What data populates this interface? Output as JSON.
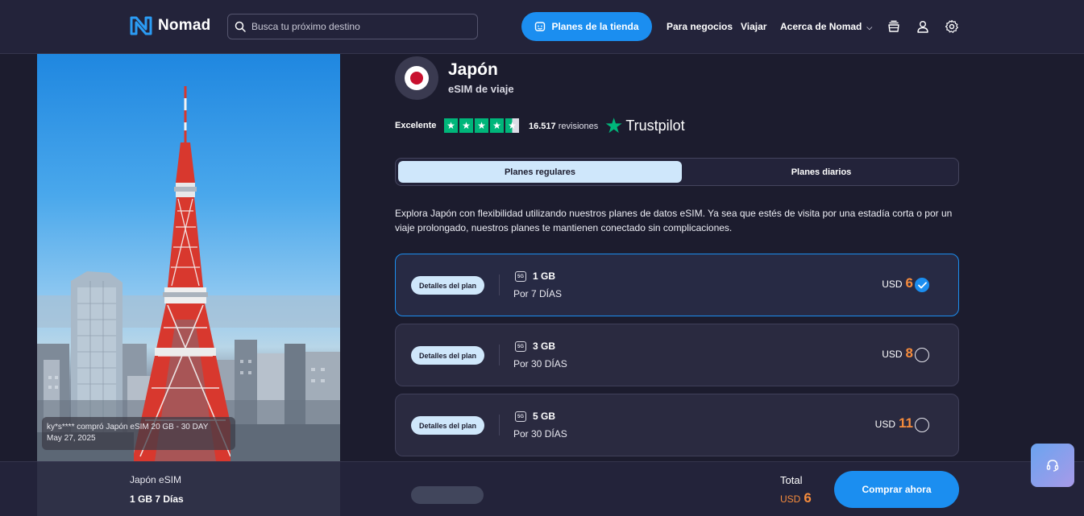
{
  "header": {
    "logo_text": "Nomad",
    "search_placeholder": "Busca tu próximo destino",
    "store_button": "Planes de la tienda",
    "nav": [
      "Para negocios",
      "Viajar",
      "Acerca de Nomad"
    ],
    "icons": [
      "cart-icon",
      "user-icon",
      "gear-icon"
    ]
  },
  "hero": {
    "purchase_notice": "ky*s**** compró Japón eSIM 20 GB - 30 DAY",
    "purchase_date": "May 27, 2025"
  },
  "product": {
    "country": "Japón",
    "subtitle": "eSIM de viaje",
    "flag_colors": {
      "background": "#ffffff",
      "circle": "#c8102e"
    }
  },
  "rating": {
    "label": "Excelente",
    "stars": 4.5,
    "count": "16.517",
    "count_word": "revisiones",
    "provider": "Trustpilot"
  },
  "tabs": {
    "regular": "Planes regulares",
    "daily": "Planes diarios",
    "active": "regular"
  },
  "description": "Explora Japón con flexibilidad utilizando nuestros planes de datos eSIM. Ya sea que estés de visita por una estadía corta o por un viaje prolongado, nuestros planes te mantienen conectado sin complicaciones.",
  "plans": [
    {
      "details_label": "Detalles del plan",
      "network": "5G",
      "data": "1 GB",
      "duration": "Por 7 DÍAS",
      "currency": "USD",
      "price": "6",
      "selected": true
    },
    {
      "details_label": "Detalles del plan",
      "network": "5G",
      "data": "3 GB",
      "duration": "Por 30 DÍAS",
      "currency": "USD",
      "price": "8",
      "selected": false
    },
    {
      "details_label": "Detalles del plan",
      "network": "5G",
      "data": "5 GB",
      "duration": "Por 30 DÍAS",
      "currency": "USD",
      "price": "11",
      "selected": false
    }
  ],
  "checkout": {
    "product_name": "Japón eSIM",
    "plan_summary": "1 GB 7 Días",
    "total_label": "Total",
    "currency": "USD",
    "total": "6",
    "buy_button": "Comprar ahora"
  },
  "colors": {
    "accent": "#1b8ef0",
    "price": "#f58b3c",
    "trustpilot": "#00b67a",
    "background": "#1c1c2e"
  }
}
